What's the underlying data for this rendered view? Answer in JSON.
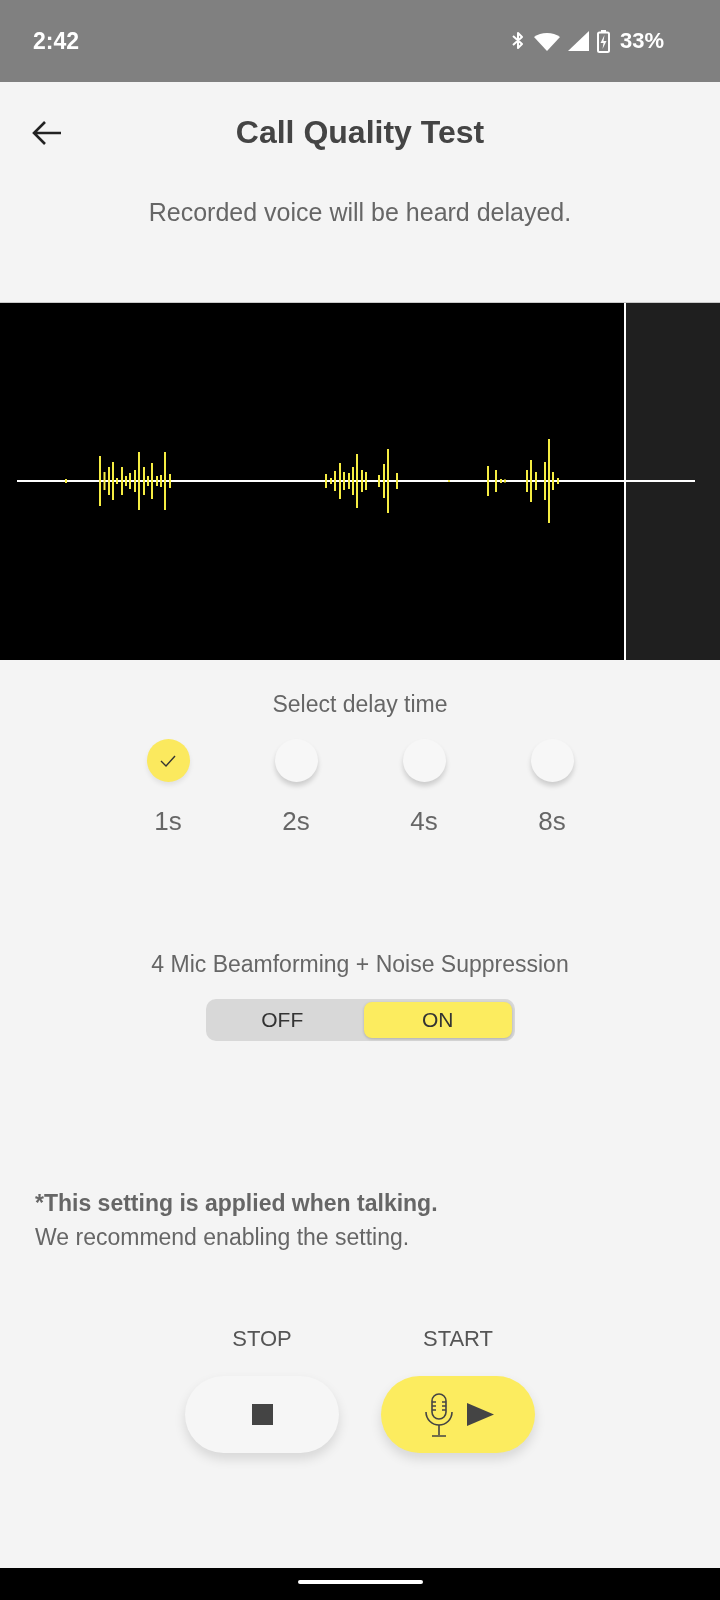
{
  "status_bar": {
    "time": "2:42",
    "battery": "33%"
  },
  "header": {
    "title": "Call Quality Test"
  },
  "subtitle": "Recorded voice will be heard delayed.",
  "delay": {
    "label": "Select delay time",
    "options": [
      {
        "label": "1s",
        "selected": true
      },
      {
        "label": "2s",
        "selected": false
      },
      {
        "label": "4s",
        "selected": false
      },
      {
        "label": "8s",
        "selected": false
      }
    ]
  },
  "beamforming": {
    "label": "4 Mic Beamforming + Noise Suppression",
    "options": [
      {
        "label": "OFF",
        "selected": false
      },
      {
        "label": "ON",
        "selected": true
      }
    ]
  },
  "note": {
    "title": "*This setting is applied when talking.",
    "body": "We recommend enabling the setting."
  },
  "controls": [
    {
      "kind": "stop",
      "label": "STOP"
    },
    {
      "kind": "start",
      "label": "START"
    }
  ]
}
